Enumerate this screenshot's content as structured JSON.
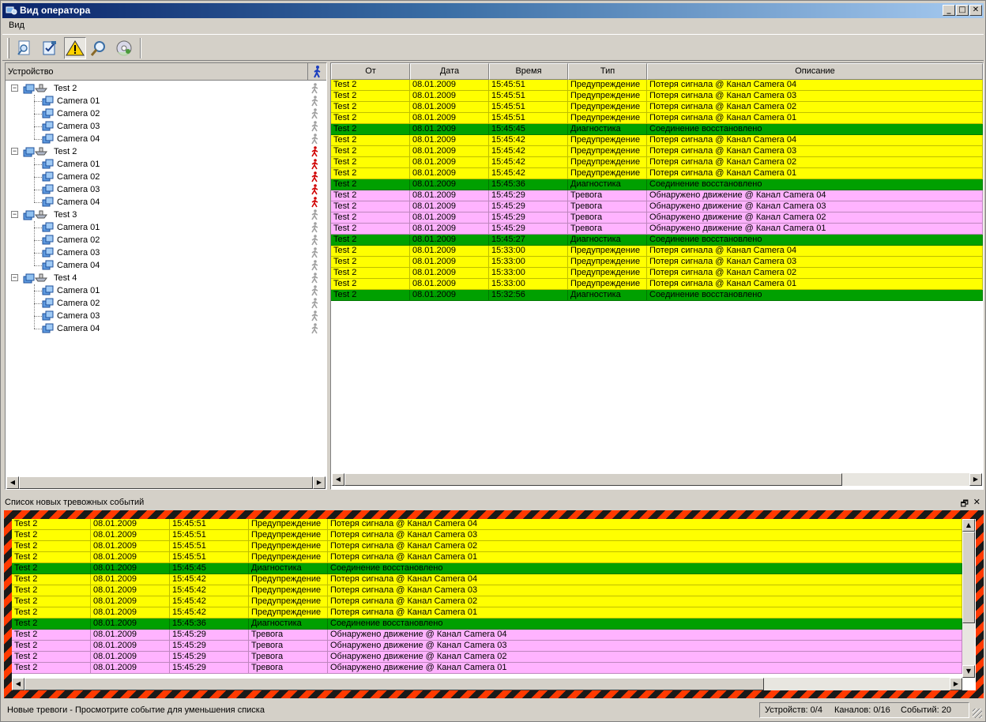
{
  "window": {
    "title": "Вид оператора",
    "min": "_",
    "max": "□",
    "close": "✕"
  },
  "menu": {
    "view": "Вид"
  },
  "toolbar": {
    "tools": [
      {
        "icon": "magnifier-page-icon"
      },
      {
        "icon": "checklist-icon"
      },
      {
        "icon": "warning-icon",
        "pressed": true
      },
      {
        "icon": "search-icon"
      },
      {
        "icon": "disc-settings-icon"
      }
    ]
  },
  "tree": {
    "header": "Устройство",
    "groups": [
      {
        "name": "Test 2",
        "cameras": [
          "Camera 01",
          "Camera 02",
          "Camera 03",
          "Camera 04"
        ],
        "alarm": false
      },
      {
        "name": "Test 2",
        "cameras": [
          "Camera 01",
          "Camera 02",
          "Camera 03",
          "Camera 04"
        ],
        "alarm": true
      },
      {
        "name": "Test 3",
        "cameras": [
          "Camera 01",
          "Camera 02",
          "Camera 03",
          "Camera 04"
        ],
        "alarm": false
      },
      {
        "name": "Test 4",
        "cameras": [
          "Camera 01",
          "Camera 02",
          "Camera 03",
          "Camera 04"
        ],
        "alarm": false
      }
    ]
  },
  "grid": {
    "columns": [
      "От",
      "Дата",
      "Время",
      "Тип",
      "Описание"
    ],
    "rows": [
      {
        "from": "Test 2",
        "date": "08.01.2009",
        "time": "15:45:51",
        "type": "Предупреждение",
        "desc": "Потеря сигнала @ Канал Camera 04",
        "kind": "y"
      },
      {
        "from": "Test 2",
        "date": "08.01.2009",
        "time": "15:45:51",
        "type": "Предупреждение",
        "desc": "Потеря сигнала @ Канал Camera 03",
        "kind": "y"
      },
      {
        "from": "Test 2",
        "date": "08.01.2009",
        "time": "15:45:51",
        "type": "Предупреждение",
        "desc": "Потеря сигнала @ Канал Camera 02",
        "kind": "y"
      },
      {
        "from": "Test 2",
        "date": "08.01.2009",
        "time": "15:45:51",
        "type": "Предупреждение",
        "desc": "Потеря сигнала @ Канал Camera 01",
        "kind": "y"
      },
      {
        "from": "Test 2",
        "date": "08.01.2009",
        "time": "15:45:45",
        "type": "Диагностика",
        "desc": "Соединение восстановлено",
        "kind": "g"
      },
      {
        "from": "Test 2",
        "date": "08.01.2009",
        "time": "15:45:42",
        "type": "Предупреждение",
        "desc": "Потеря сигнала @ Канал Camera 04",
        "kind": "y"
      },
      {
        "from": "Test 2",
        "date": "08.01.2009",
        "time": "15:45:42",
        "type": "Предупреждение",
        "desc": "Потеря сигнала @ Канал Camera 03",
        "kind": "y"
      },
      {
        "from": "Test 2",
        "date": "08.01.2009",
        "time": "15:45:42",
        "type": "Предупреждение",
        "desc": "Потеря сигнала @ Канал Camera 02",
        "kind": "y"
      },
      {
        "from": "Test 2",
        "date": "08.01.2009",
        "time": "15:45:42",
        "type": "Предупреждение",
        "desc": "Потеря сигнала @ Канал Camera 01",
        "kind": "y"
      },
      {
        "from": "Test 2",
        "date": "08.01.2009",
        "time": "15:45:36",
        "type": "Диагностика",
        "desc": "Соединение восстановлено",
        "kind": "g"
      },
      {
        "from": "Test 2",
        "date": "08.01.2009",
        "time": "15:45:29",
        "type": "Тревога",
        "desc": "Обнаружено движение @ Канал Camera 04",
        "kind": "p"
      },
      {
        "from": "Test 2",
        "date": "08.01.2009",
        "time": "15:45:29",
        "type": "Тревога",
        "desc": "Обнаружено движение @ Канал Camera 03",
        "kind": "p"
      },
      {
        "from": "Test 2",
        "date": "08.01.2009",
        "time": "15:45:29",
        "type": "Тревога",
        "desc": "Обнаружено движение @ Канал Camera 02",
        "kind": "p"
      },
      {
        "from": "Test 2",
        "date": "08.01.2009",
        "time": "15:45:29",
        "type": "Тревога",
        "desc": "Обнаружено движение @ Канал Camera 01",
        "kind": "p"
      },
      {
        "from": "Test 2",
        "date": "08.01.2009",
        "time": "15:45:27",
        "type": "Диагностика",
        "desc": "Соединение восстановлено",
        "kind": "g"
      },
      {
        "from": "Test 2",
        "date": "08.01.2009",
        "time": "15:33:00",
        "type": "Предупреждение",
        "desc": "Потеря сигнала @ Канал Camera 04",
        "kind": "y"
      },
      {
        "from": "Test 2",
        "date": "08.01.2009",
        "time": "15:33:00",
        "type": "Предупреждение",
        "desc": "Потеря сигнала @ Канал Camera 03",
        "kind": "y"
      },
      {
        "from": "Test 2",
        "date": "08.01.2009",
        "time": "15:33:00",
        "type": "Предупреждение",
        "desc": "Потеря сигнала @ Канал Camera 02",
        "kind": "y"
      },
      {
        "from": "Test 2",
        "date": "08.01.2009",
        "time": "15:33:00",
        "type": "Предупреждение",
        "desc": "Потеря сигнала @ Канал Camera 01",
        "kind": "y"
      },
      {
        "from": "Test 2",
        "date": "08.01.2009",
        "time": "15:32:56",
        "type": "Диагностика",
        "desc": "Соединение восстановлено",
        "kind": "g"
      }
    ]
  },
  "alarms": {
    "caption": "Список новых тревожных событий",
    "float": "🗗",
    "close": "✕",
    "rows": [
      {
        "from": "Test 2",
        "date": "08.01.2009",
        "time": "15:45:51",
        "type": "Предупреждение",
        "desc": "Потеря сигнала @ Канал Camera 04",
        "kind": "y"
      },
      {
        "from": "Test 2",
        "date": "08.01.2009",
        "time": "15:45:51",
        "type": "Предупреждение",
        "desc": "Потеря сигнала @ Канал Camera 03",
        "kind": "y"
      },
      {
        "from": "Test 2",
        "date": "08.01.2009",
        "time": "15:45:51",
        "type": "Предупреждение",
        "desc": "Потеря сигнала @ Канал Camera 02",
        "kind": "y"
      },
      {
        "from": "Test 2",
        "date": "08.01.2009",
        "time": "15:45:51",
        "type": "Предупреждение",
        "desc": "Потеря сигнала @ Канал Camera 01",
        "kind": "y"
      },
      {
        "from": "Test 2",
        "date": "08.01.2009",
        "time": "15:45:45",
        "type": "Диагностика",
        "desc": "Соединение восстановлено",
        "kind": "g"
      },
      {
        "from": "Test 2",
        "date": "08.01.2009",
        "time": "15:45:42",
        "type": "Предупреждение",
        "desc": "Потеря сигнала @ Канал Camera 04",
        "kind": "y"
      },
      {
        "from": "Test 2",
        "date": "08.01.2009",
        "time": "15:45:42",
        "type": "Предупреждение",
        "desc": "Потеря сигнала @ Канал Camera 03",
        "kind": "y"
      },
      {
        "from": "Test 2",
        "date": "08.01.2009",
        "time": "15:45:42",
        "type": "Предупреждение",
        "desc": "Потеря сигнала @ Канал Camera 02",
        "kind": "y"
      },
      {
        "from": "Test 2",
        "date": "08.01.2009",
        "time": "15:45:42",
        "type": "Предупреждение",
        "desc": "Потеря сигнала @ Канал Camera 01",
        "kind": "y"
      },
      {
        "from": "Test 2",
        "date": "08.01.2009",
        "time": "15:45:36",
        "type": "Диагностика",
        "desc": "Соединение восстановлено",
        "kind": "g"
      },
      {
        "from": "Test 2",
        "date": "08.01.2009",
        "time": "15:45:29",
        "type": "Тревога",
        "desc": "Обнаружено движение @ Канал Camera 04",
        "kind": "p"
      },
      {
        "from": "Test 2",
        "date": "08.01.2009",
        "time": "15:45:29",
        "type": "Тревога",
        "desc": "Обнаружено движение @ Канал Camera 03",
        "kind": "p"
      },
      {
        "from": "Test 2",
        "date": "08.01.2009",
        "time": "15:45:29",
        "type": "Тревога",
        "desc": "Обнаружено движение @ Канал Camera 02",
        "kind": "p"
      },
      {
        "from": "Test 2",
        "date": "08.01.2009",
        "time": "15:45:29",
        "type": "Тревога",
        "desc": "Обнаружено движение @ Канал Camera 01",
        "kind": "p"
      }
    ]
  },
  "status": {
    "message": "Новые тревоги - Просмотрите событие для уменьшения списка",
    "devices": "Устройств: 0/4",
    "channels": "Каналов: 0/16",
    "events": "Событий: 20"
  },
  "colors": {
    "warning": "#ffff00",
    "diagnostic": "#00a000",
    "alarm": "#ffb3ff",
    "title_start": "#0a246a"
  }
}
